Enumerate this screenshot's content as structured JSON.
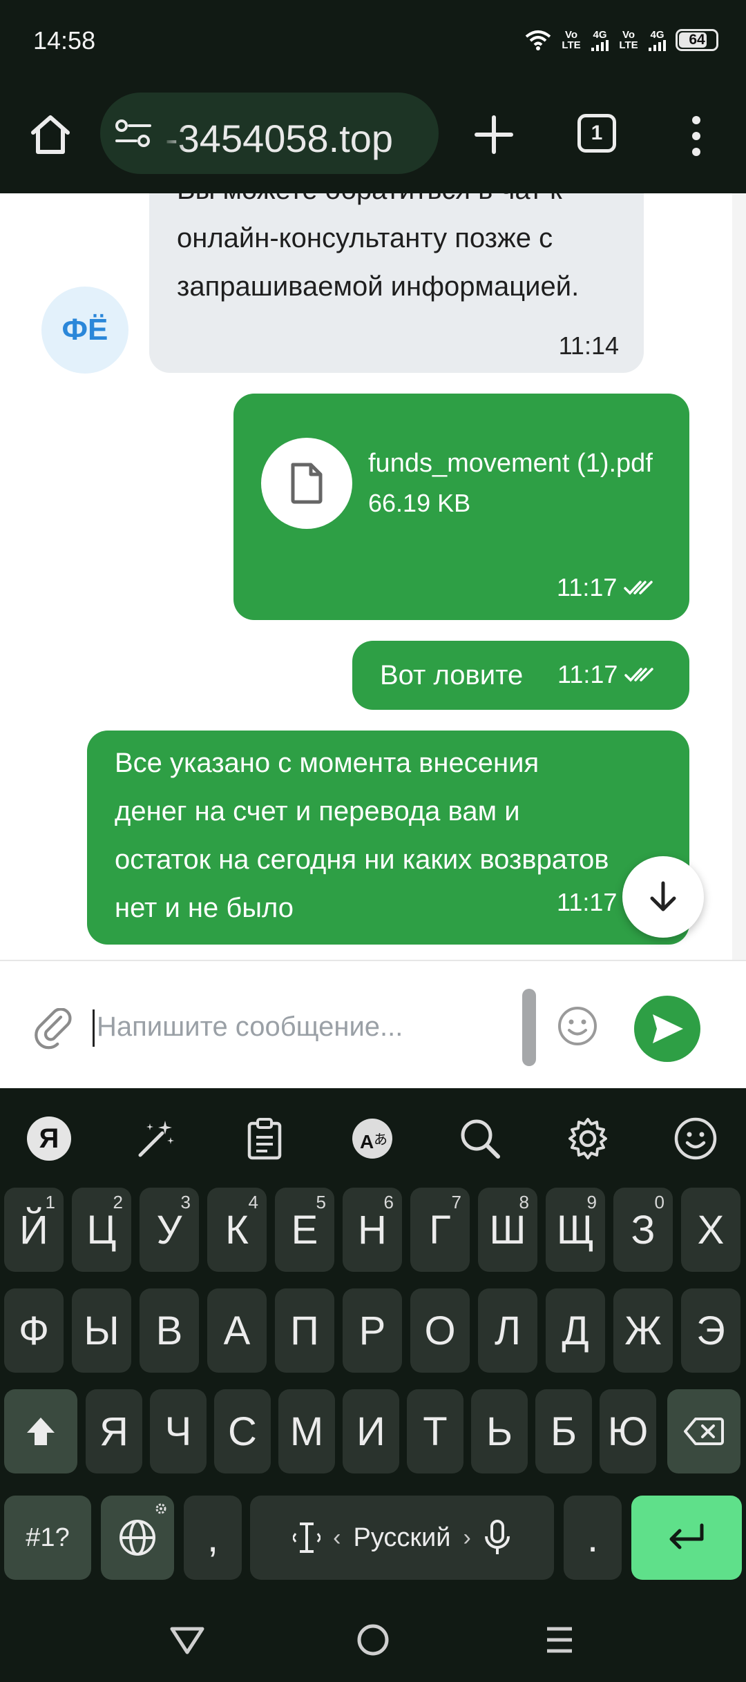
{
  "status_bar": {
    "time": "14:58",
    "sim1_label": "Vo LTE",
    "sim1_network": "4G",
    "sim2_label": "Vo LTE",
    "sim2_network": "4G",
    "battery": "64"
  },
  "browser": {
    "url": "-3454058.top",
    "tab_count": "1",
    "icons": [
      "home-icon",
      "site-settings-icon",
      "plus-icon",
      "tab-switcher-icon",
      "more-vert-icon"
    ]
  },
  "chat": {
    "incoming": {
      "avatar_initials": "ФЁ",
      "text": "Вы можете обратиться в чат к онлайн-консультанту позже с запрашиваемой информацией.",
      "time": "11:14"
    },
    "file_message": {
      "file_name": "funds_movement (1).pdf",
      "file_size": "66.19 KB",
      "time": "11:17",
      "icon": "document-icon"
    },
    "short_message": {
      "text": "Вот ловите",
      "time": "11:17"
    },
    "long_message": {
      "text": "Все указано с момента внесения денег на счет и перевода вам и остаток на сегодня ни каких возвратов нет и не было",
      "time": "11:17"
    }
  },
  "composer": {
    "placeholder": "Напишите сообщение...",
    "value": ""
  },
  "keyboard": {
    "toolbar_icons": [
      "yandex-logo",
      "magic-wand-icon",
      "clipboard-icon",
      "translate-icon",
      "search-icon",
      "settings-icon",
      "emoji-icon"
    ],
    "logo_letter": "Я",
    "row1": [
      {
        "label": "Й",
        "hint": "1"
      },
      {
        "label": "Ц",
        "hint": "2"
      },
      {
        "label": "У",
        "hint": "3"
      },
      {
        "label": "К",
        "hint": "4"
      },
      {
        "label": "Е",
        "hint": "5"
      },
      {
        "label": "Н",
        "hint": "6"
      },
      {
        "label": "Г",
        "hint": "7"
      },
      {
        "label": "Ш",
        "hint": "8"
      },
      {
        "label": "Щ",
        "hint": "9"
      },
      {
        "label": "З",
        "hint": "0"
      },
      {
        "label": "Х",
        "hint": ""
      }
    ],
    "row2": [
      "Ф",
      "Ы",
      "В",
      "А",
      "П",
      "Р",
      "О",
      "Л",
      "Д",
      "Ж",
      "Э"
    ],
    "row3": [
      "Я",
      "Ч",
      "С",
      "М",
      "И",
      "Т",
      "Ь",
      "Б",
      "Ю"
    ],
    "symbols_label": "#1?",
    "comma_label": ",",
    "language_label": "Русский",
    "period_label": "."
  }
}
